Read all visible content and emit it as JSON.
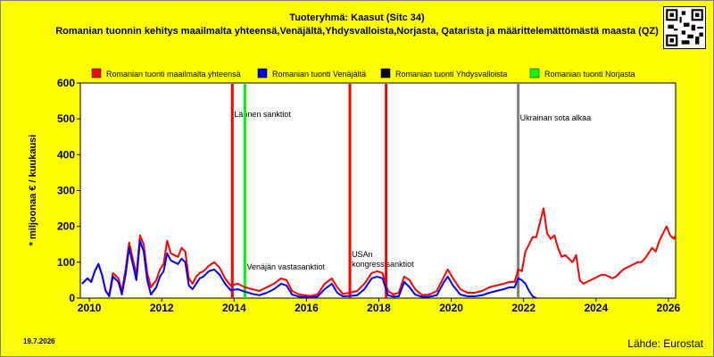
{
  "header": {
    "title": "Tuoteryhmä: Kaasut (Sitc 34)",
    "subtitle": "Romanian tuonnin kehitys maailmalta yhteensä,Venäjältä,Yhdysvalloista,Norjasta, Qatarista ja määrittelemättömästä maasta (QZ)"
  },
  "footer": {
    "date": "19.7.2026",
    "source": "Lähde: Eurostat"
  },
  "chart_data": {
    "type": "line",
    "ylabel": "* miljoonaa € / kuukausi",
    "xlabel": "",
    "xlim": [
      2009.75,
      2026.2
    ],
    "ylim": [
      0,
      600
    ],
    "yticks": [
      0,
      100,
      200,
      300,
      400,
      500,
      600
    ],
    "xticks": [
      2010,
      2012,
      2014,
      2016,
      2018,
      2020,
      2022,
      2024,
      2026
    ],
    "grid": false,
    "legend_position": "top",
    "series": [
      {
        "name": "Romanian tuonti maailmalta yhteensä",
        "color": "#ff0000",
        "points": [
          [
            2009.8,
            40
          ],
          [
            2009.95,
            55
          ],
          [
            2010.05,
            45
          ],
          [
            2010.15,
            75
          ],
          [
            2010.25,
            95
          ],
          [
            2010.35,
            65
          ],
          [
            2010.45,
            20
          ],
          [
            2010.55,
            8
          ],
          [
            2010.65,
            70
          ],
          [
            2010.8,
            55
          ],
          [
            2010.9,
            20
          ],
          [
            2011.0,
            80
          ],
          [
            2011.1,
            155
          ],
          [
            2011.2,
            110
          ],
          [
            2011.3,
            65
          ],
          [
            2011.4,
            175
          ],
          [
            2011.5,
            150
          ],
          [
            2011.6,
            70
          ],
          [
            2011.7,
            30
          ],
          [
            2011.85,
            50
          ],
          [
            2011.95,
            80
          ],
          [
            2012.05,
            95
          ],
          [
            2012.15,
            160
          ],
          [
            2012.25,
            125
          ],
          [
            2012.35,
            120
          ],
          [
            2012.45,
            115
          ],
          [
            2012.55,
            140
          ],
          [
            2012.65,
            130
          ],
          [
            2012.75,
            55
          ],
          [
            2012.85,
            40
          ],
          [
            2012.95,
            60
          ],
          [
            2013.05,
            70
          ],
          [
            2013.15,
            75
          ],
          [
            2013.3,
            90
          ],
          [
            2013.45,
            100
          ],
          [
            2013.6,
            85
          ],
          [
            2013.75,
            55
          ],
          [
            2013.9,
            35
          ],
          [
            2014.1,
            40
          ],
          [
            2014.3,
            30
          ],
          [
            2014.5,
            25
          ],
          [
            2014.7,
            20
          ],
          [
            2014.9,
            30
          ],
          [
            2015.1,
            40
          ],
          [
            2015.3,
            55
          ],
          [
            2015.45,
            50
          ],
          [
            2015.6,
            20
          ],
          [
            2015.8,
            10
          ],
          [
            2015.95,
            8
          ],
          [
            2016.1,
            6
          ],
          [
            2016.3,
            10
          ],
          [
            2016.5,
            40
          ],
          [
            2016.7,
            55
          ],
          [
            2016.85,
            30
          ],
          [
            2017.0,
            12
          ],
          [
            2017.2,
            15
          ],
          [
            2017.4,
            20
          ],
          [
            2017.6,
            40
          ],
          [
            2017.8,
            70
          ],
          [
            2017.95,
            75
          ],
          [
            2018.1,
            70
          ],
          [
            2018.25,
            20
          ],
          [
            2018.4,
            10
          ],
          [
            2018.55,
            15
          ],
          [
            2018.7,
            60
          ],
          [
            2018.85,
            50
          ],
          [
            2019.0,
            25
          ],
          [
            2019.2,
            8
          ],
          [
            2019.4,
            10
          ],
          [
            2019.6,
            20
          ],
          [
            2019.8,
            60
          ],
          [
            2019.9,
            80
          ],
          [
            2020.05,
            55
          ],
          [
            2020.25,
            25
          ],
          [
            2020.45,
            15
          ],
          [
            2020.65,
            15
          ],
          [
            2020.85,
            20
          ],
          [
            2021.05,
            30
          ],
          [
            2021.25,
            35
          ],
          [
            2021.45,
            40
          ],
          [
            2021.6,
            45
          ],
          [
            2021.75,
            45
          ],
          [
            2021.85,
            80
          ],
          [
            2021.95,
            75
          ],
          [
            2022.05,
            130
          ],
          [
            2022.15,
            150
          ],
          [
            2022.25,
            170
          ],
          [
            2022.35,
            170
          ],
          [
            2022.45,
            210
          ],
          [
            2022.55,
            250
          ],
          [
            2022.65,
            180
          ],
          [
            2022.75,
            165
          ],
          [
            2022.85,
            175
          ],
          [
            2022.95,
            140
          ],
          [
            2023.05,
            115
          ],
          [
            2023.15,
            120
          ],
          [
            2023.25,
            110
          ],
          [
            2023.35,
            100
          ],
          [
            2023.45,
            120
          ],
          [
            2023.55,
            50
          ],
          [
            2023.65,
            40
          ],
          [
            2023.75,
            45
          ],
          [
            2023.85,
            50
          ],
          [
            2023.95,
            55
          ],
          [
            2024.05,
            60
          ],
          [
            2024.15,
            65
          ],
          [
            2024.25,
            65
          ],
          [
            2024.35,
            60
          ],
          [
            2024.45,
            55
          ],
          [
            2024.55,
            60
          ],
          [
            2024.65,
            70
          ],
          [
            2024.75,
            80
          ],
          [
            2024.85,
            85
          ],
          [
            2024.95,
            90
          ],
          [
            2025.05,
            95
          ],
          [
            2025.15,
            100
          ],
          [
            2025.25,
            100
          ],
          [
            2025.35,
            110
          ],
          [
            2025.45,
            125
          ],
          [
            2025.55,
            140
          ],
          [
            2025.65,
            130
          ],
          [
            2025.75,
            160
          ],
          [
            2025.85,
            180
          ],
          [
            2025.95,
            200
          ],
          [
            2026.05,
            175
          ],
          [
            2026.15,
            165
          ],
          [
            2026.2,
            175
          ]
        ]
      },
      {
        "name": "Romanian tuonti Venäjältä",
        "color": "#0000ff",
        "points": [
          [
            2009.8,
            40
          ],
          [
            2009.95,
            55
          ],
          [
            2010.05,
            45
          ],
          [
            2010.15,
            75
          ],
          [
            2010.25,
            95
          ],
          [
            2010.35,
            65
          ],
          [
            2010.45,
            20
          ],
          [
            2010.55,
            5
          ],
          [
            2010.65,
            60
          ],
          [
            2010.8,
            45
          ],
          [
            2010.9,
            10
          ],
          [
            2011.0,
            65
          ],
          [
            2011.1,
            140
          ],
          [
            2011.2,
            95
          ],
          [
            2011.3,
            50
          ],
          [
            2011.4,
            160
          ],
          [
            2011.5,
            130
          ],
          [
            2011.6,
            50
          ],
          [
            2011.7,
            10
          ],
          [
            2011.85,
            30
          ],
          [
            2011.95,
            60
          ],
          [
            2012.05,
            75
          ],
          [
            2012.15,
            125
          ],
          [
            2012.25,
            105
          ],
          [
            2012.35,
            100
          ],
          [
            2012.45,
            95
          ],
          [
            2012.55,
            110
          ],
          [
            2012.65,
            100
          ],
          [
            2012.75,
            35
          ],
          [
            2012.85,
            25
          ],
          [
            2012.95,
            40
          ],
          [
            2013.05,
            55
          ],
          [
            2013.15,
            60
          ],
          [
            2013.3,
            75
          ],
          [
            2013.45,
            80
          ],
          [
            2013.6,
            65
          ],
          [
            2013.75,
            40
          ],
          [
            2013.9,
            22
          ],
          [
            2014.1,
            25
          ],
          [
            2014.3,
            18
          ],
          [
            2014.5,
            12
          ],
          [
            2014.7,
            8
          ],
          [
            2014.9,
            15
          ],
          [
            2015.1,
            25
          ],
          [
            2015.3,
            40
          ],
          [
            2015.45,
            35
          ],
          [
            2015.6,
            10
          ],
          [
            2015.8,
            4
          ],
          [
            2015.95,
            3
          ],
          [
            2016.1,
            2
          ],
          [
            2016.3,
            4
          ],
          [
            2016.5,
            25
          ],
          [
            2016.7,
            40
          ],
          [
            2016.85,
            15
          ],
          [
            2017.0,
            5
          ],
          [
            2017.2,
            6
          ],
          [
            2017.4,
            8
          ],
          [
            2017.6,
            25
          ],
          [
            2017.8,
            55
          ],
          [
            2017.95,
            60
          ],
          [
            2018.1,
            55
          ],
          [
            2018.25,
            8
          ],
          [
            2018.4,
            4
          ],
          [
            2018.55,
            5
          ],
          [
            2018.7,
            45
          ],
          [
            2018.85,
            30
          ],
          [
            2019.0,
            10
          ],
          [
            2019.2,
            3
          ],
          [
            2019.4,
            4
          ],
          [
            2019.6,
            8
          ],
          [
            2019.8,
            45
          ],
          [
            2019.9,
            60
          ],
          [
            2020.05,
            35
          ],
          [
            2020.25,
            10
          ],
          [
            2020.45,
            5
          ],
          [
            2020.65,
            5
          ],
          [
            2020.85,
            8
          ],
          [
            2021.05,
            15
          ],
          [
            2021.25,
            20
          ],
          [
            2021.45,
            25
          ],
          [
            2021.6,
            30
          ],
          [
            2021.75,
            30
          ],
          [
            2021.85,
            55
          ],
          [
            2021.95,
            50
          ],
          [
            2022.05,
            40
          ],
          [
            2022.15,
            20
          ],
          [
            2022.25,
            5
          ],
          [
            2022.35,
            0
          ]
        ]
      },
      {
        "name": "Romanian tuonti Yhdysvalloista",
        "color": "#000000",
        "points": []
      },
      {
        "name": "Romanian tuonti Norjasta",
        "color": "#00ff00",
        "points": []
      }
    ],
    "events": [
      {
        "label": "Lännen sanktiot",
        "x": 2013.95,
        "color": "#ff0000",
        "label_y": 505
      },
      {
        "label": "Venäjän vastasanktiot",
        "x": 2014.3,
        "color": "#00ff00",
        "label_y": 80
      },
      {
        "label": "USAn kongressisanktiot",
        "x": 2017.2,
        "color": "#ff0000",
        "label_y": 115
      },
      {
        "label": "",
        "x": 2018.2,
        "color": "#ff0000",
        "label_y": 0
      },
      {
        "label": "Ukrainan sota alkaa",
        "x": 2021.85,
        "color": "#808080",
        "label_y": 495
      }
    ]
  }
}
